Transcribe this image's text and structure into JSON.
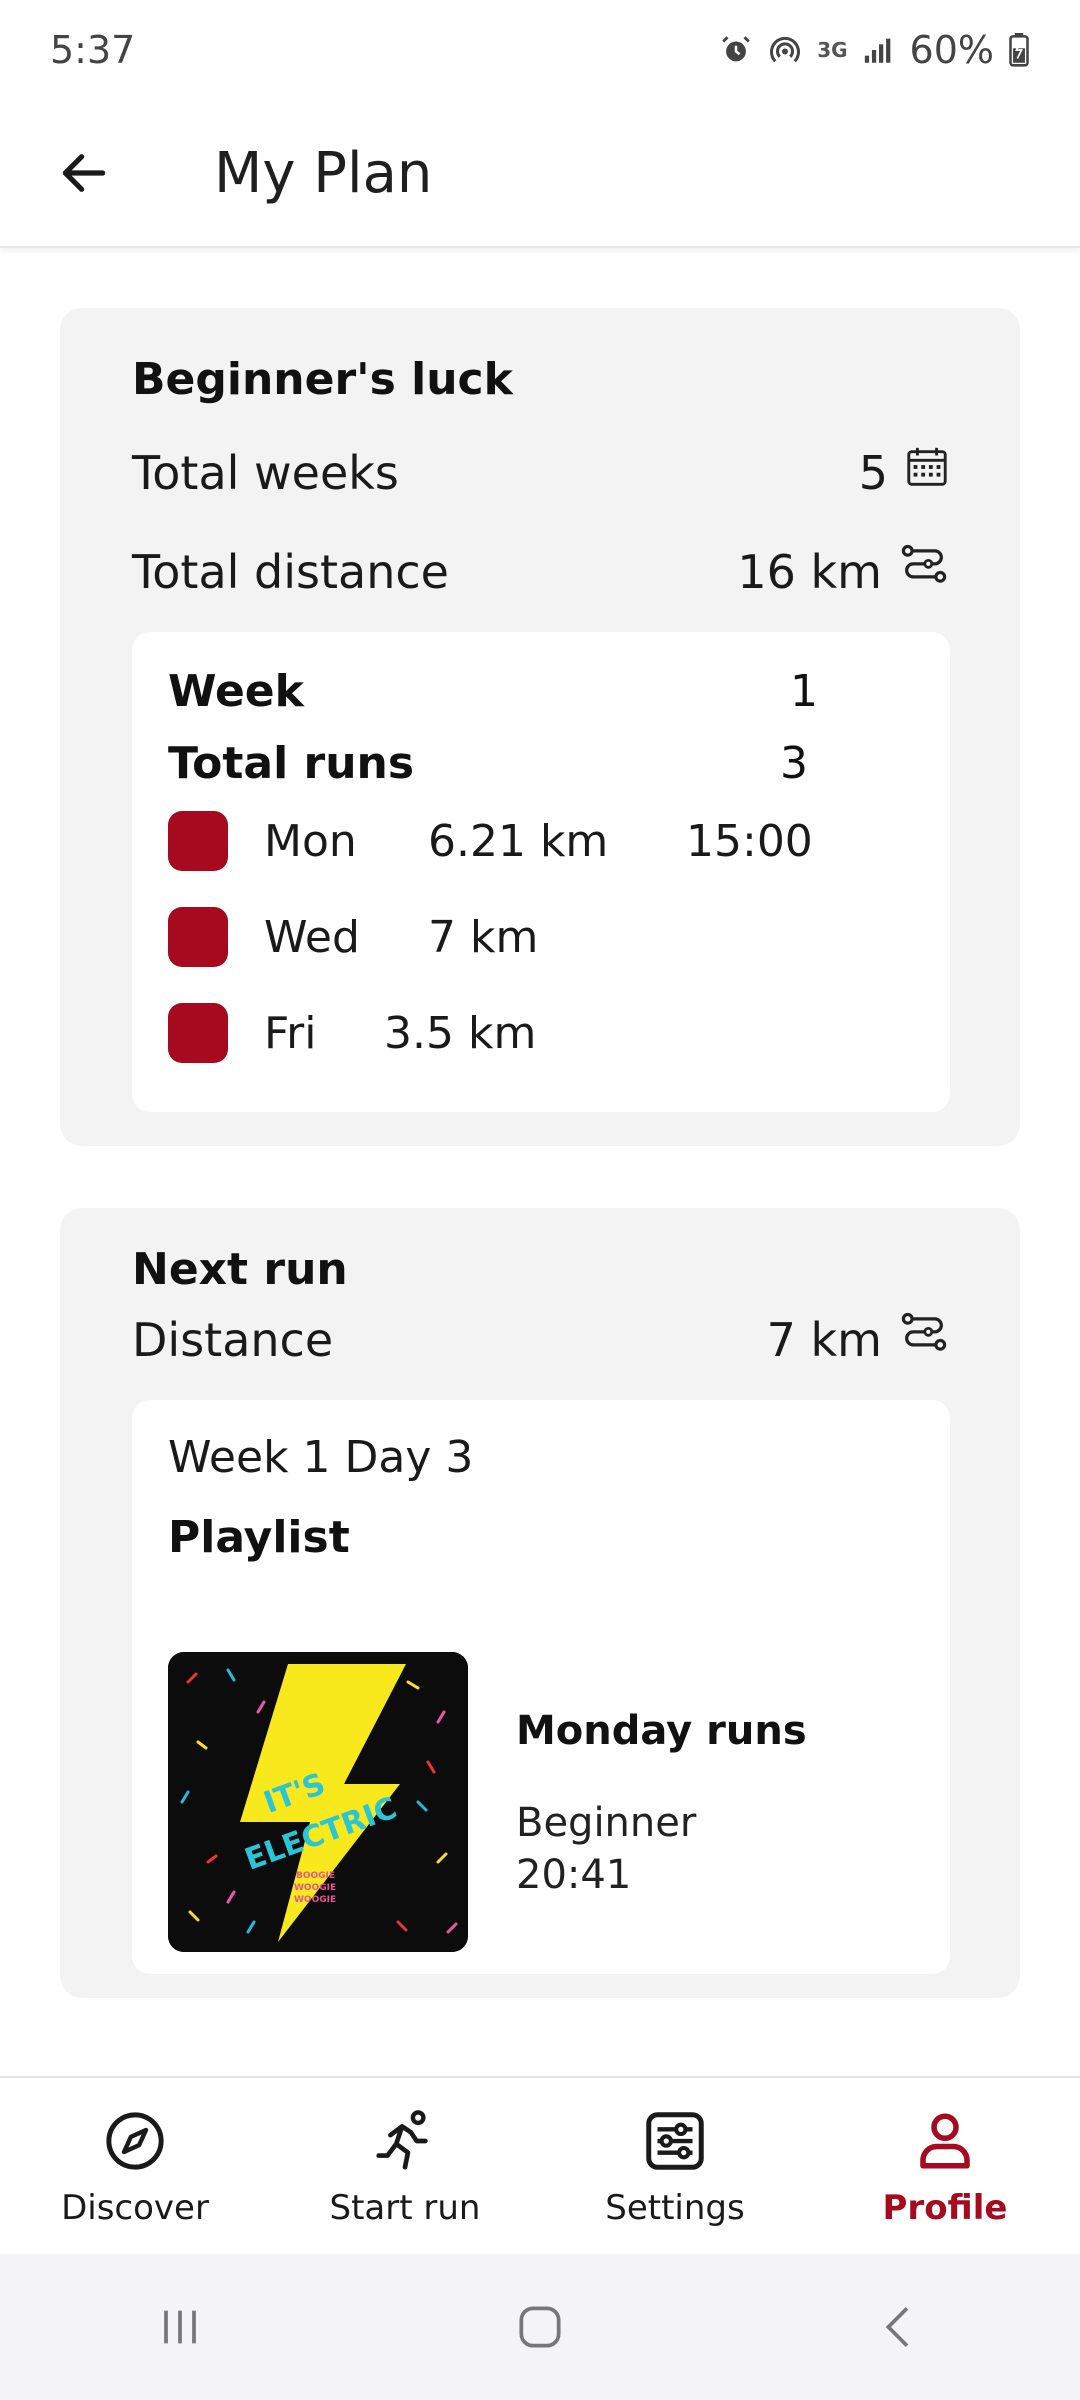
{
  "status_bar": {
    "time": "5:37",
    "network": "3G",
    "battery": "60%"
  },
  "app_bar": {
    "title": "My Plan"
  },
  "plan": {
    "name": "Beginner's luck",
    "total_weeks_label": "Total weeks",
    "total_weeks_value": "5",
    "total_distance_label": "Total distance",
    "total_distance_value": "16 km",
    "week_label": "Week",
    "week_value": "1",
    "total_runs_label": "Total runs",
    "total_runs_value": "3",
    "runs": [
      {
        "day": "Mon",
        "distance": "6.21 km",
        "time": "15:00"
      },
      {
        "day": "Wed",
        "distance": "7 km",
        "time": ""
      },
      {
        "day": "Fri",
        "distance": "3.5 km",
        "time": ""
      }
    ]
  },
  "next_run": {
    "title": "Next run",
    "distance_label": "Distance",
    "distance_value": "7 km",
    "week_day": "Week 1 Day 3",
    "playlist_label": "Playlist",
    "album_text": "IT'S ELECTRIC",
    "album_subtext": "BOOGIE WOOGIE WOOGIE",
    "playlist_name": "Monday runs",
    "playlist_level": "Beginner",
    "playlist_duration": "20:41"
  },
  "bottom_nav": {
    "items": [
      {
        "label": "Discover",
        "icon": "compass-icon"
      },
      {
        "label": "Start run",
        "icon": "running-icon"
      },
      {
        "label": "Settings",
        "icon": "sliders-icon"
      },
      {
        "label": "Profile",
        "icon": "person-icon"
      }
    ],
    "active": "Profile"
  },
  "colors": {
    "accent": "#a50a1e",
    "card_bg": "#f3f3f3",
    "album_yellow": "#f7e91c",
    "album_cyan": "#28c6d6"
  }
}
